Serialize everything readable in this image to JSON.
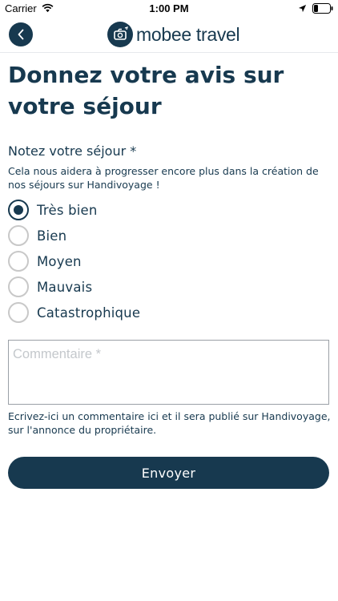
{
  "status_bar": {
    "carrier": "Carrier",
    "time": "1:00 PM",
    "icons": [
      "wifi-icon",
      "location-arrow-icon",
      "battery-icon"
    ]
  },
  "header": {
    "back_icon": "chevron-left-icon",
    "logo_text": "mobee travel"
  },
  "page": {
    "title": "Donnez votre avis sur votre séjour"
  },
  "rating": {
    "label": "Notez votre séjour *",
    "help": "Cela nous aidera à progresser encore plus dans la création de nos séjours sur Handivoyage !",
    "options": [
      {
        "label": "Très bien",
        "selected": true
      },
      {
        "label": "Bien",
        "selected": false
      },
      {
        "label": "Moyen",
        "selected": false
      },
      {
        "label": "Mauvais",
        "selected": false
      },
      {
        "label": "Catastrophique",
        "selected": false
      }
    ]
  },
  "comment": {
    "value": "",
    "placeholder": "Commentaire *",
    "help": "Ecrivez-ici un commentaire ici et il sera publié sur Handivoyage, sur l'annonce du propriétaire."
  },
  "submit": {
    "label": "Envoyer"
  },
  "colors": {
    "primary": "#17394f",
    "radio_border": "#c8c8c8",
    "placeholder": "#c4c8cc"
  }
}
